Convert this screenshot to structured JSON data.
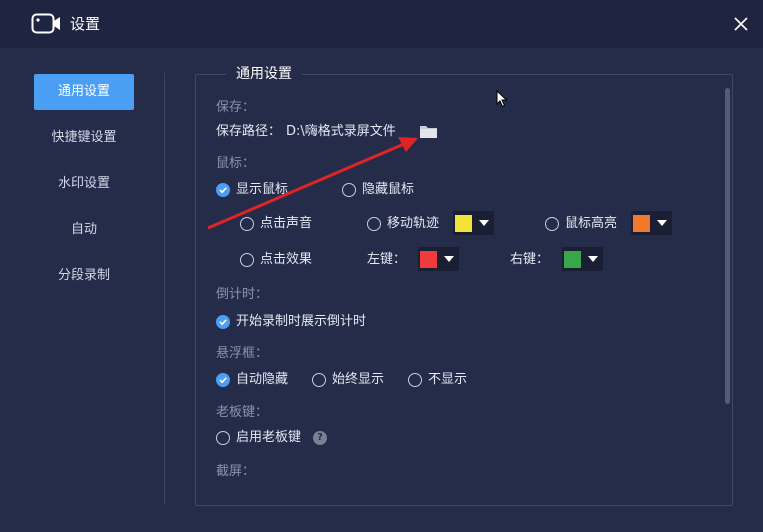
{
  "window": {
    "title": "设置"
  },
  "nav": {
    "items": [
      {
        "label": "通用设置",
        "active": true
      },
      {
        "label": "快捷键设置",
        "active": false
      },
      {
        "label": "水印设置",
        "active": false
      },
      {
        "label": "自动",
        "active": false
      },
      {
        "label": "分段录制",
        "active": false
      }
    ]
  },
  "panel": {
    "title": "通用设置",
    "save": {
      "section": "保存：",
      "path_label": "保存路径：",
      "path_value": "D:\\嗨格式录屏文件"
    },
    "mouse": {
      "section": "鼠标：",
      "show_cursor": "显示鼠标",
      "hide_cursor": "隐藏鼠标",
      "click_sound": "点击声音",
      "move_track": "移动轨迹",
      "cursor_highlight": "鼠标高亮",
      "click_effect": "点击效果",
      "left_key": "左键：",
      "right_key": "右键：",
      "track_color": "#f2e33a",
      "highlight_color": "#f07a2a",
      "left_color": "#ee3c3c",
      "right_color": "#3aa64a"
    },
    "countdown": {
      "section": "倒计时：",
      "show_countdown": "开始录制时展示倒计时"
    },
    "floating": {
      "section": "悬浮框：",
      "auto_hide": "自动隐藏",
      "always_show": "始终显示",
      "never_show": "不显示"
    },
    "boss_key": {
      "section": "老板键：",
      "enable": "启用老板键",
      "help": "?"
    },
    "screenshot": {
      "section": "截屏："
    }
  }
}
